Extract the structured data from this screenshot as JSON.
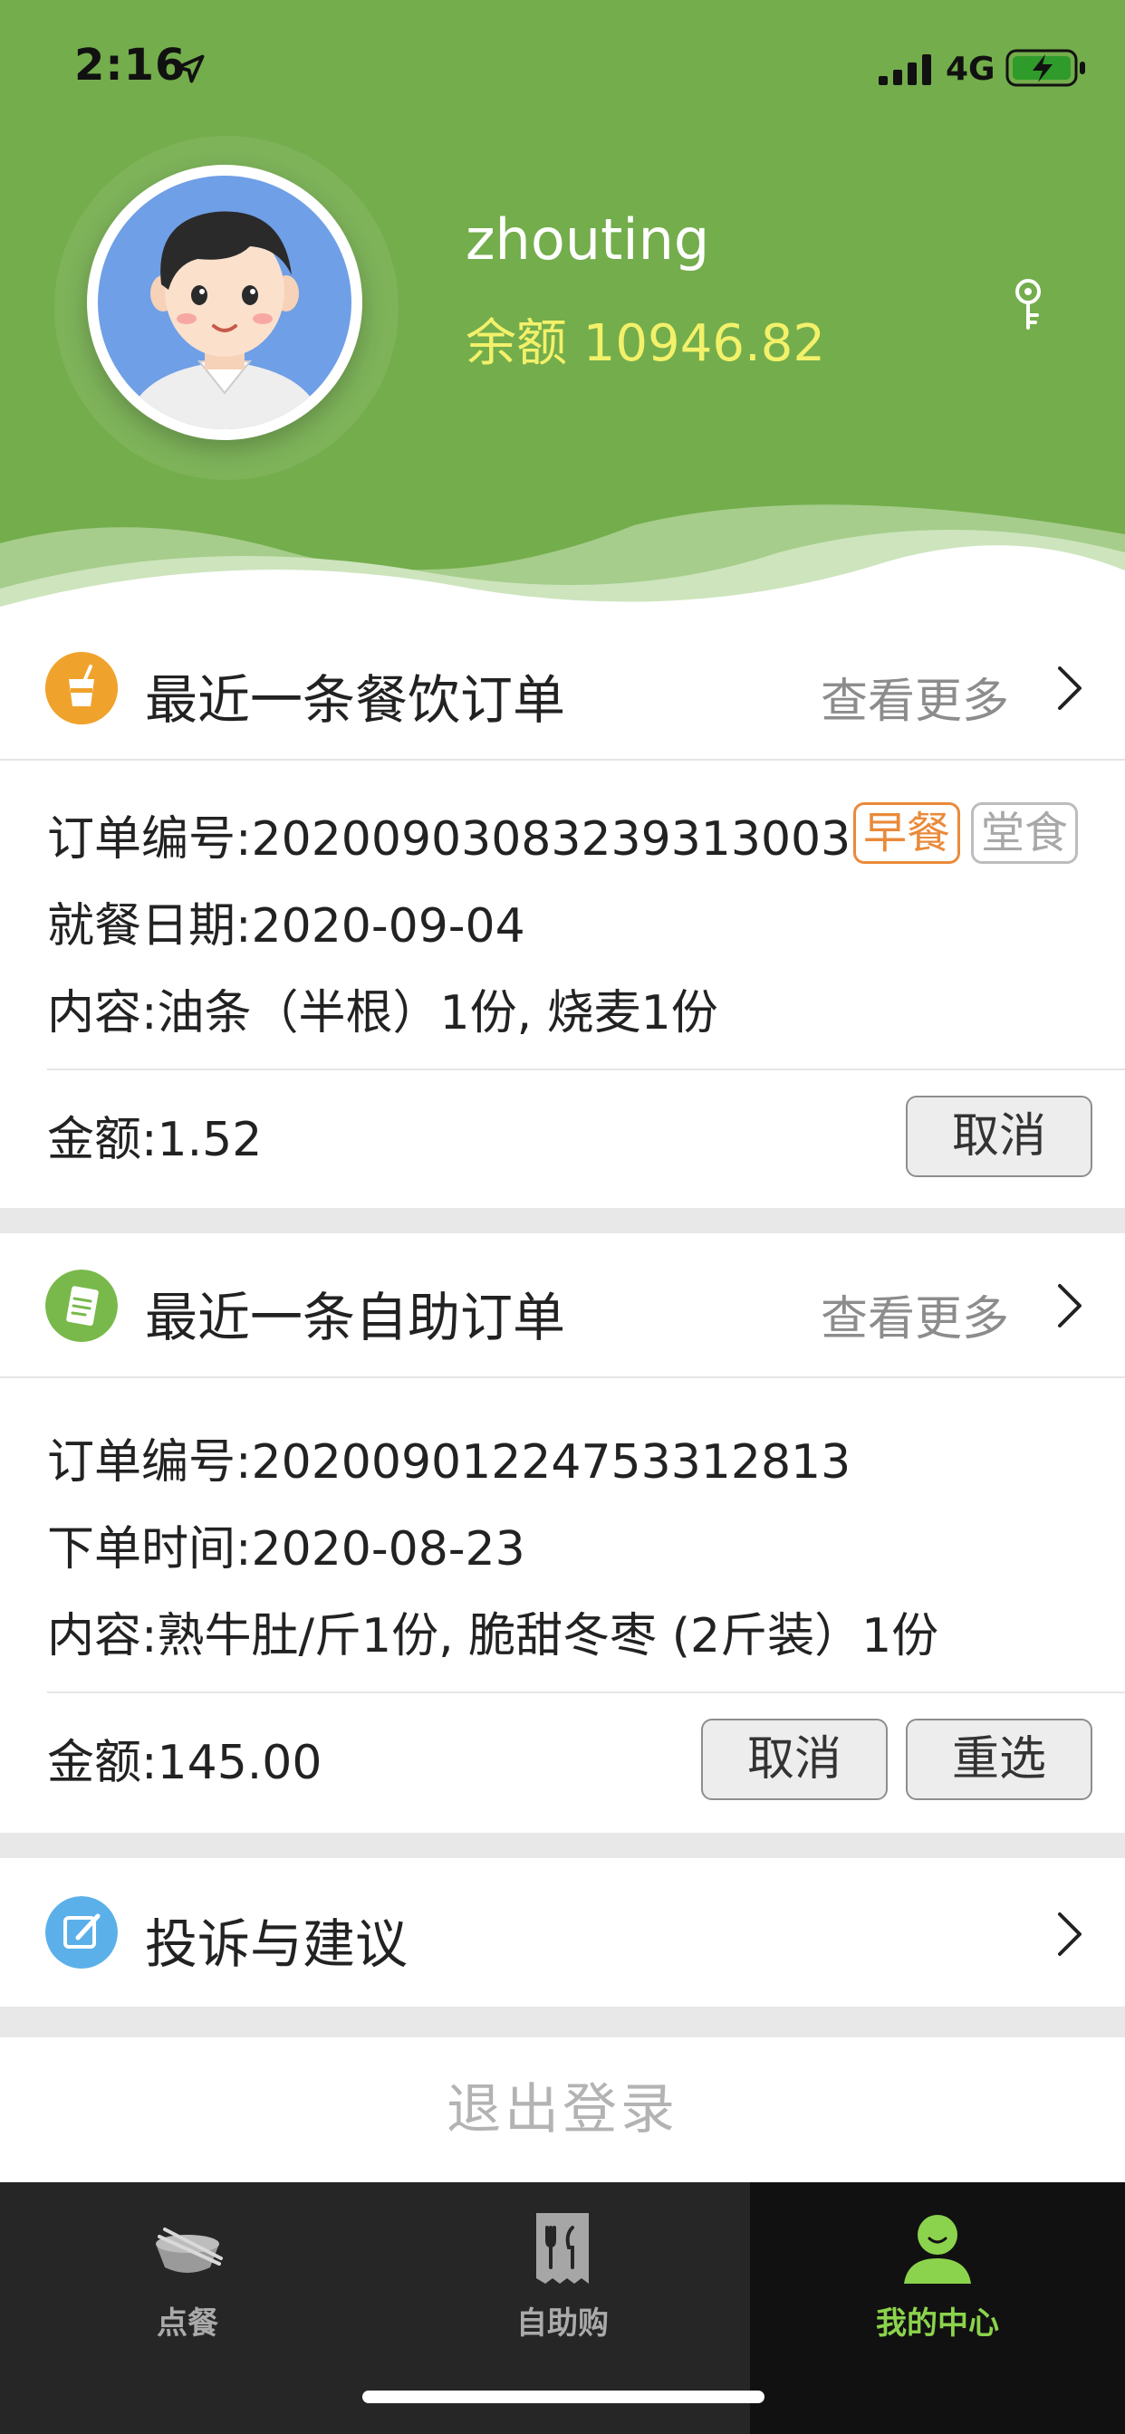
{
  "status_bar": {
    "time": "2:16",
    "network": "4G"
  },
  "profile": {
    "username": "zhouting",
    "balance": "余额 10946.82"
  },
  "dining_order": {
    "title": "最近一条餐饮订单",
    "more": "查看更多",
    "order_no": "订单编号:20200903083239313003",
    "tag_meal": "早餐",
    "tag_type": "堂食",
    "date": "就餐日期:2020-09-04",
    "content": "内容:油条（半根）1份, 烧麦1份",
    "amount": "金额:1.52",
    "cancel_label": "取消"
  },
  "self_order": {
    "title": "最近一条自助订单",
    "more": "查看更多",
    "order_no": "订单编号:20200901224753312813",
    "time": "下单时间:2020-08-23",
    "content": "内容:熟牛肚/斤1份, 脆甜冬枣 (2斤装）1份",
    "amount": "金额:145.00",
    "cancel_label": "取消",
    "reselect_label": "重选"
  },
  "feedback": {
    "title": "投诉与建议"
  },
  "logout_label": "退出登录",
  "tabs": [
    {
      "label": "点餐",
      "icon": "bowl-icon"
    },
    {
      "label": "自助购",
      "icon": "receipt-utensils-icon"
    },
    {
      "label": "我的中心",
      "icon": "user-icon",
      "active": true
    }
  ],
  "colors": {
    "header_green": "#74ad4c",
    "balance_yellow": "#f3f16a",
    "accent_orange": "#f0a32c",
    "accent_green": "#79b94c",
    "accent_blue": "#5bb0ea",
    "active_tab": "#8bd34c"
  }
}
